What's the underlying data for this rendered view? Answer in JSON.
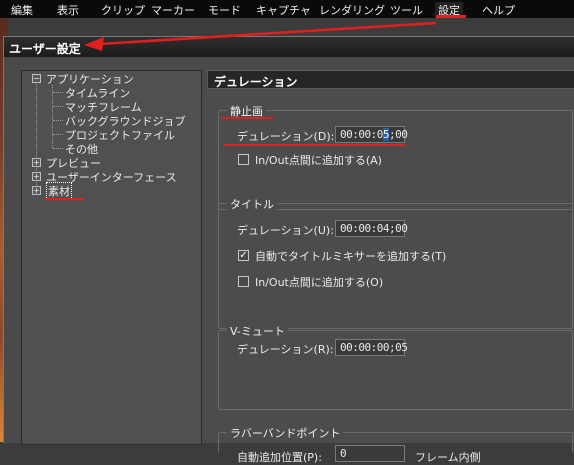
{
  "menubar": {
    "items": [
      "編集",
      "表示",
      "クリップ",
      "マーカー",
      "モード",
      "キャプチャ",
      "レンダリング",
      "ツール",
      "設定",
      "ヘルプ"
    ],
    "active_item": "設定"
  },
  "dialog": {
    "title": "ユーザー設定"
  },
  "tree": {
    "root_application": "アプリケーション",
    "application_children": [
      "タイムライン",
      "マッチフレーム",
      "バックグラウンドジョブ",
      "プロジェクトファイル",
      "その他"
    ],
    "preview": "プレビュー",
    "user_interface": "ユーザーインターフェース",
    "material": "素材",
    "toggle_expanded": "−",
    "toggle_collapsed": "+"
  },
  "content": {
    "header": "デュレーション",
    "still_image": {
      "legend": "静止画",
      "duration_label": "デュレーション(D):",
      "duration_value_prefix": "00:00:0",
      "duration_value_selected": "5",
      "duration_value_suffix": ";00",
      "inout_label": "In/Out点間に追加する(A)",
      "inout_checked": false
    },
    "title": {
      "legend": "タイトル",
      "duration_label": "デュレーション(U):",
      "duration_value": "00:00:04;00",
      "auto_mixer_label": "自動でタイトルミキサーを追加する(T)",
      "auto_mixer_checked": true,
      "inout_label": "In/Out点間に追加する(O)",
      "inout_checked": false
    },
    "v_mute": {
      "legend": "V-ミュート",
      "duration_label": "デュレーション(R):",
      "duration_value": "00:00:00;05"
    },
    "rubberband": {
      "legend": "ラバーバンドポイント",
      "position_label": "自動追加位置(P):",
      "position_value": "0",
      "unit_label": "フレーム内側"
    }
  },
  "colors": {
    "annotation_red": "#e0201e",
    "menubar_bg": "#0a0a0a",
    "panel_bg": "#4c4c4c"
  },
  "checkmark_glyph": "✓"
}
